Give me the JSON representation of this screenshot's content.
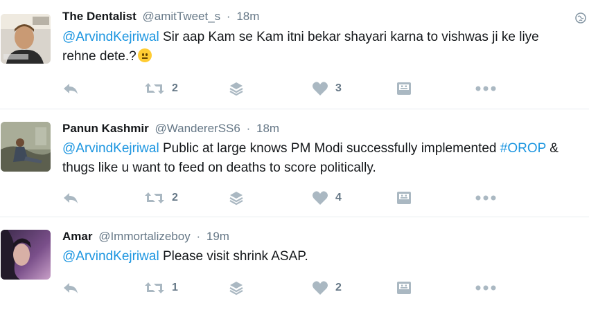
{
  "tweets": [
    {
      "fullname": "The Dentalist",
      "handle": "@amitTweet_s",
      "separator": "·",
      "time": "18m",
      "mention": "@ArvindKejriwal",
      "text": "Sir aap Kam se Kam itni bekar shayari karna to vishwas ji ke liye rehne dete.?",
      "retweets": "2",
      "likes": "3",
      "avatar_icon": "person-avatar"
    },
    {
      "fullname": "Panun Kashmir",
      "handle": "@WandererSS6",
      "separator": "·",
      "time": "18m",
      "mention": "@ArvindKejriwal",
      "text_part1": "Public at large knows PM Modi successfully implemented",
      "hashtag": "#OROP",
      "text_part2": "& thugs like u want to feed on deaths to score politically.",
      "retweets": "2",
      "likes": "4",
      "avatar_icon": "person-avatar"
    },
    {
      "fullname": "Amar",
      "handle": "@Immortalizeboy",
      "separator": "·",
      "time": "19m",
      "mention": "@ArvindKejriwal",
      "text": "Please visit shrink ASAP.",
      "retweets": "1",
      "likes": "2",
      "avatar_icon": "person-avatar"
    }
  ],
  "icons": {
    "reply": "reply-icon",
    "retweet": "retweet-icon",
    "layers": "layers-icon",
    "like": "heart-icon",
    "card": "card-icon",
    "more": "more-icon",
    "globe": "globe-icon"
  },
  "colors": {
    "link": "#1b95e0",
    "muted": "#657786",
    "icon": "#aab8c2",
    "divider": "#e6ecf0"
  }
}
